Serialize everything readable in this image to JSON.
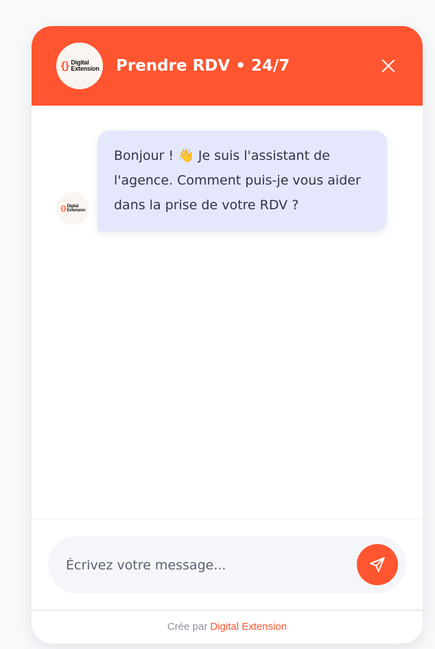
{
  "header": {
    "logo": {
      "mark": "{}",
      "line1": "Digital",
      "line2": "Extension"
    },
    "title": "Prendre RDV • 24/7",
    "close_icon": "close-icon"
  },
  "messages": [
    {
      "sender": "bot",
      "avatar": {
        "mark": "{}",
        "line1": "Digital",
        "line2": "Extension"
      },
      "text": "Bonjour ! 👋 Je suis l'assistant de l'agence. Comment puis-je vous aider dans la prise de votre RDV ?"
    }
  ],
  "composer": {
    "placeholder": "Écrivez votre message...",
    "value": "",
    "send_icon": "send-icon"
  },
  "footer": {
    "prefix": "Crée par",
    "link": "Digital Extension"
  },
  "colors": {
    "accent": "#ff5530",
    "bubble_bg": "#e5e8fc",
    "page_bg": "#f8f9fb"
  }
}
